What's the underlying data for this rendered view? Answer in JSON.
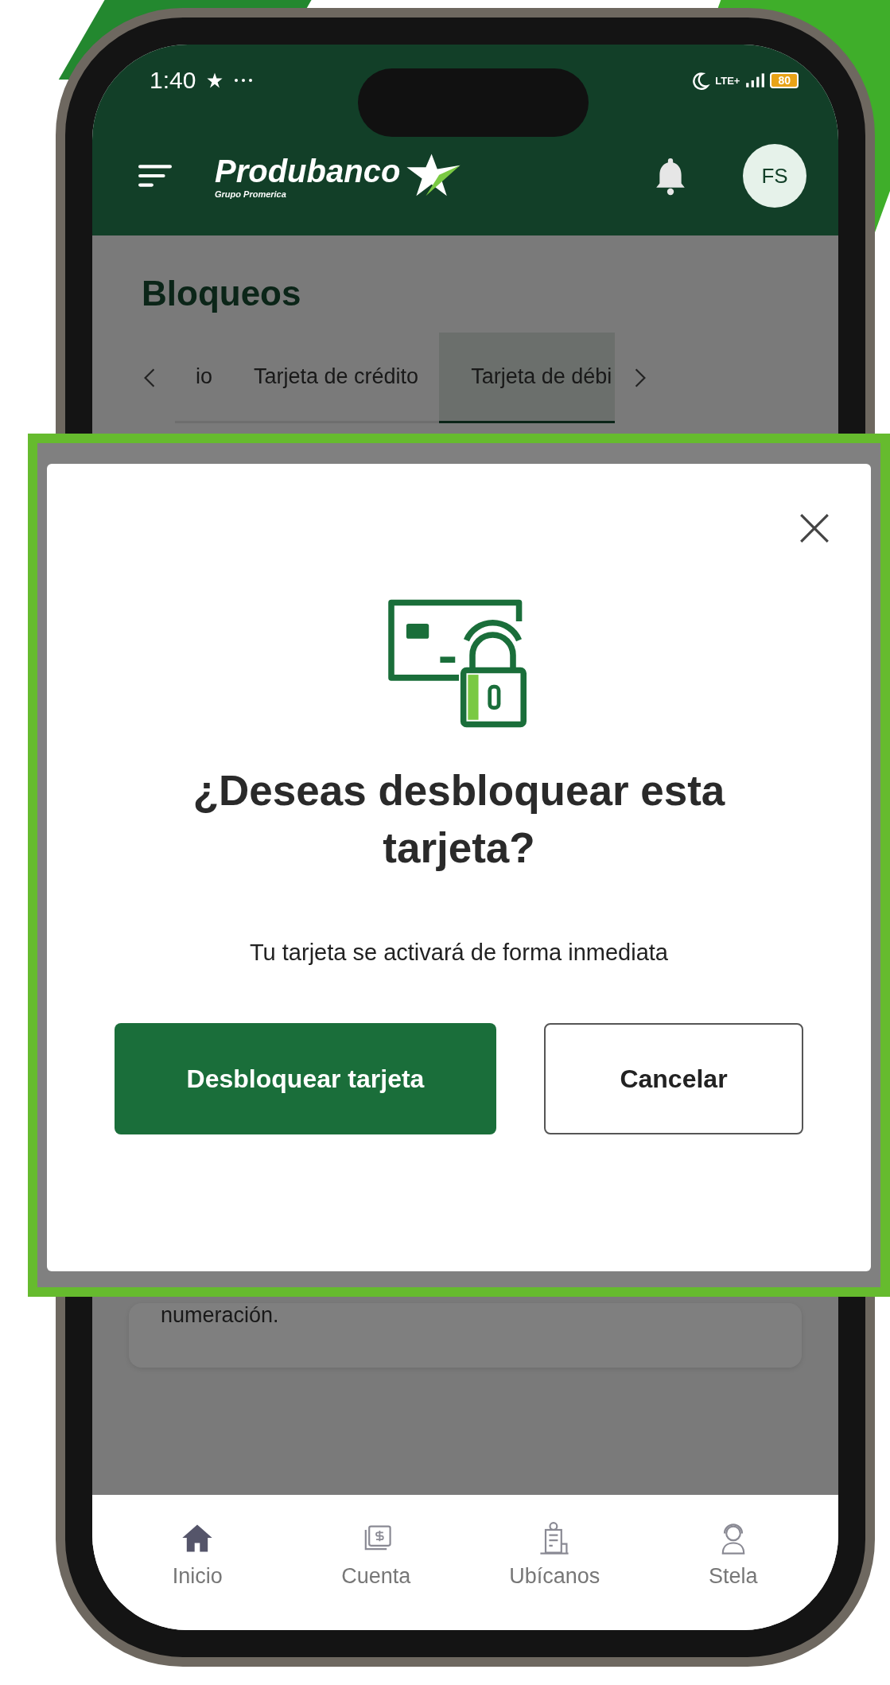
{
  "status_bar": {
    "time": "1:40",
    "network": "LTE+",
    "battery": "80"
  },
  "header": {
    "brand": "Produbanco",
    "brand_subtitle": "Grupo Promerica",
    "avatar": "FS"
  },
  "page": {
    "title": "Bloqueos",
    "tabs": [
      {
        "label": "io",
        "selected": false
      },
      {
        "label": "Tarjeta de crédito",
        "selected": false
      },
      {
        "label": "Tarjeta de débi",
        "selected": true
      }
    ],
    "card_text": "numeración."
  },
  "dialog": {
    "title": "¿Deseas desbloquear esta tarjeta?",
    "message": "Tu tarjeta se activará de forma inmediata",
    "buttons": [
      {
        "label": "Desbloquear tarjeta",
        "kind": "primary"
      },
      {
        "label": "Cancelar",
        "kind": "secondary"
      }
    ]
  },
  "bottom_nav": [
    {
      "label": "Inicio",
      "kind": "home",
      "selected": true
    },
    {
      "label": "Cuenta",
      "kind": "money",
      "selected": false
    },
    {
      "label": "Ubícanos",
      "kind": "building",
      "selected": false
    },
    {
      "label": "Stela",
      "kind": "agent",
      "selected": false
    }
  ]
}
